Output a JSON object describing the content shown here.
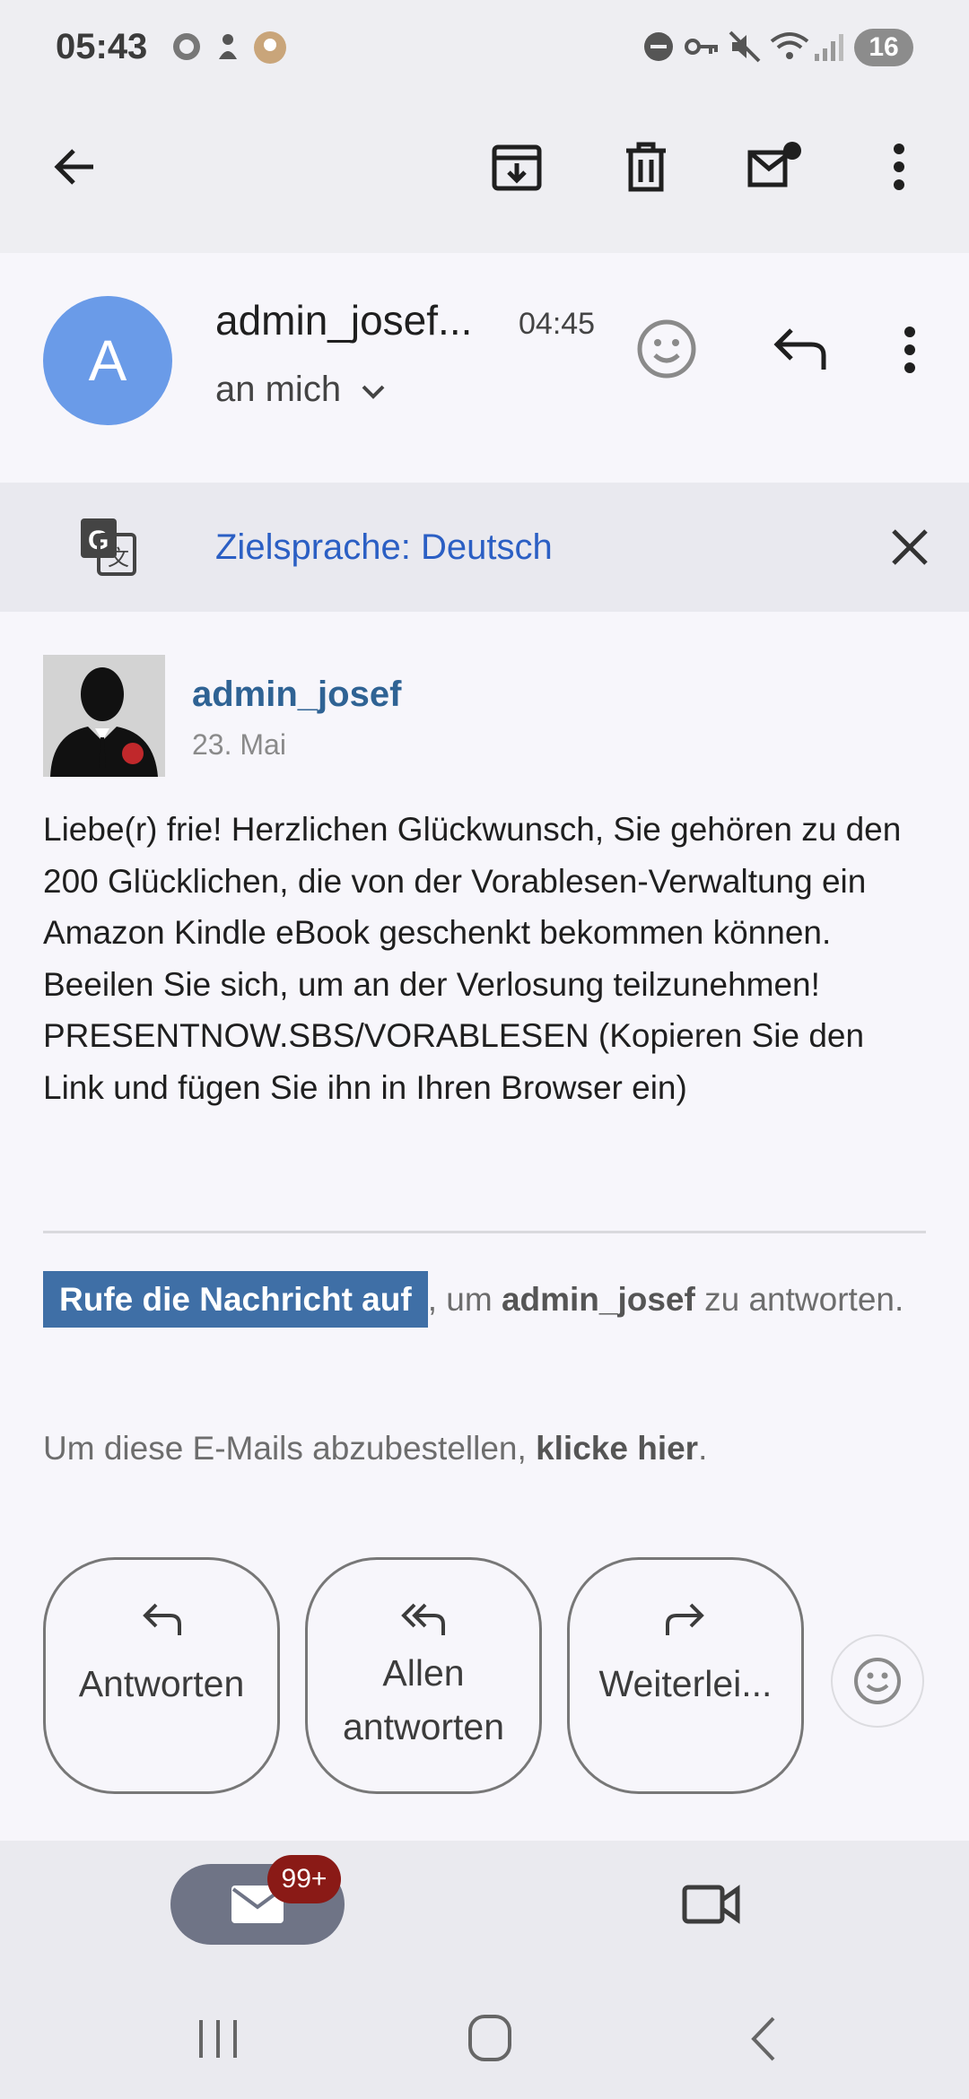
{
  "status_bar": {
    "time": "05:43",
    "battery": "16"
  },
  "toolbar": {
    "back": "back",
    "archive": "archive",
    "delete": "delete",
    "mark_unread": "mark unread",
    "more": "more"
  },
  "header": {
    "avatar_letter": "A",
    "sender": "admin_josef...",
    "time": "04:45",
    "recipient": "an mich"
  },
  "translate": {
    "label": "Zielsprache: Deutsch"
  },
  "message": {
    "username": "admin_josef",
    "date": "23. Mai",
    "body": "Liebe(r) frie! Herzlichen Glückwunsch, Sie gehören zu den 200 Glücklichen, die von der Vorablesen-Verwaltung ein Amazon Kindle eBook geschenkt bekommen können. Beeilen Sie sich, um an der Verlosung teilzunehmen! PRESENTNOW.SBS/VORABLESEN (Kopieren Sie den Link und fügen Sie ihn in Ihren Browser ein)",
    "cta_button": "Rufe die Nachricht auf",
    "cta_mid": ", um ",
    "cta_name": "admin_josef",
    "cta_tail": " zu antworten.",
    "unsub_prefix": "Um diese E-Mails abzubestellen, ",
    "unsub_link": "klicke hier",
    "unsub_suffix": "."
  },
  "actions": {
    "reply": "Antworten",
    "reply_all": "Allen antworten",
    "forward": "Weiterlei..."
  },
  "bottom_nav": {
    "badge": "99+"
  },
  "icons": [
    "back-arrow-icon",
    "archive-icon",
    "trash-icon",
    "mark-unread-icon",
    "more-vert-icon",
    "emoji-icon",
    "reply-icon",
    "translate-icon",
    "close-icon",
    "reply-all-icon",
    "forward-icon",
    "mail-icon",
    "video-icon"
  ],
  "colors": {
    "accent": "#2b5fc4",
    "avatar": "#6a9be8",
    "cta": "#3f6fa6",
    "badge": "#8a1a16"
  }
}
